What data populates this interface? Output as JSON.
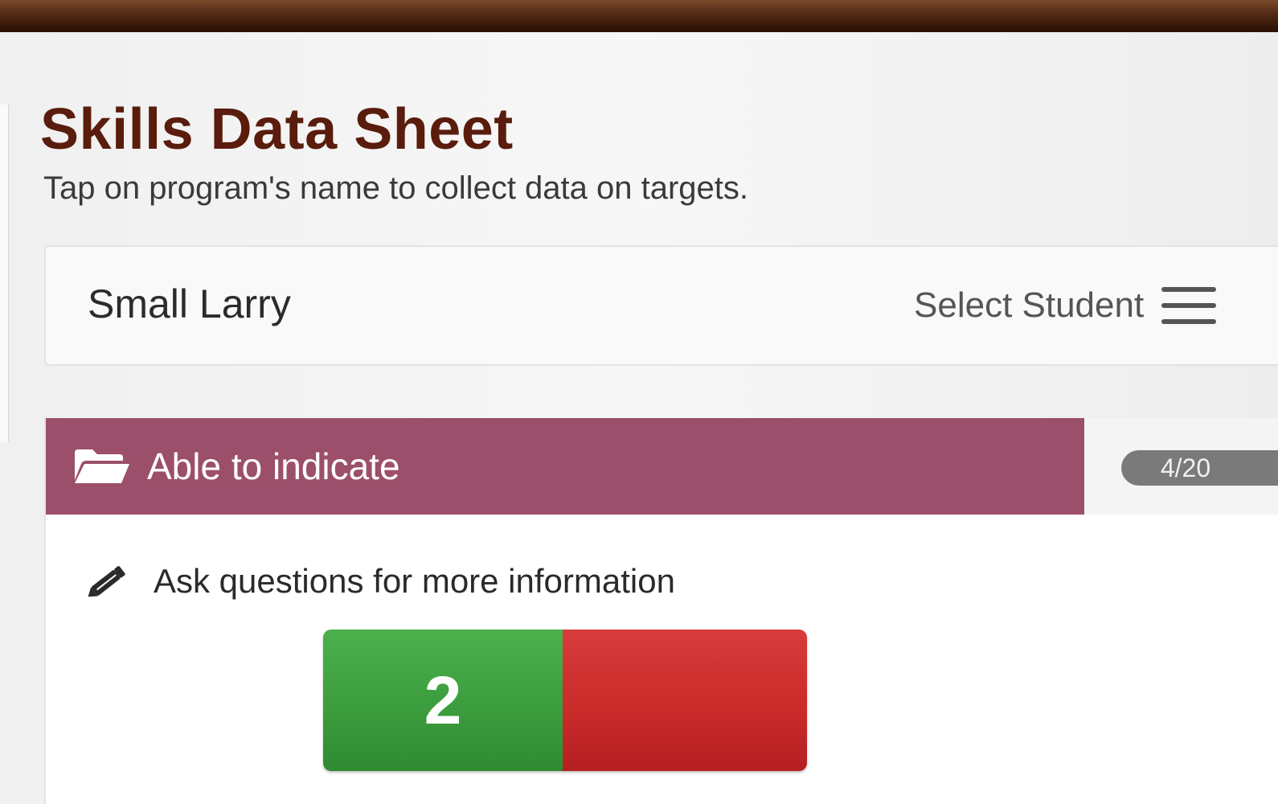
{
  "page": {
    "title": "Skills Data Sheet",
    "subtitle": "Tap on program's name to collect data on targets."
  },
  "student_bar": {
    "student_name": "Small Larry",
    "select_label": "Select Student",
    "icon": "hamburger-menu-icon"
  },
  "program": {
    "name": "Able to indicate",
    "icon": "folder-open-icon",
    "header_color": "#9c4f6a",
    "count_badge": "4/20"
  },
  "target": {
    "icon": "pencil-icon",
    "label": "Ask questions for more information",
    "correct_count": "2",
    "incorrect_count": "",
    "correct_color": "#3a9b3c",
    "incorrect_color": "#c92a2a"
  }
}
